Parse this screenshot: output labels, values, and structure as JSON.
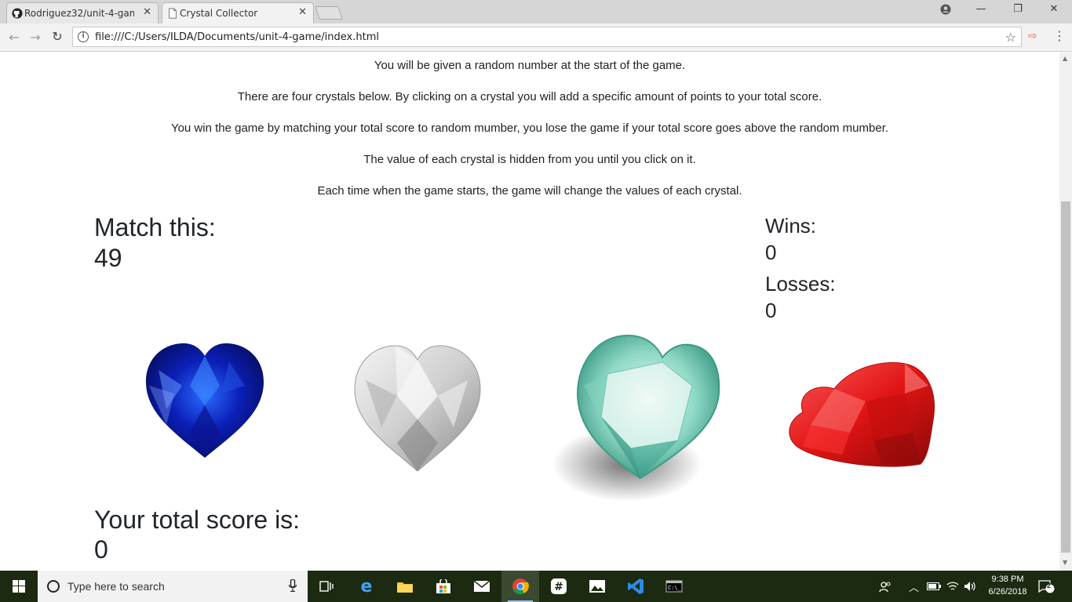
{
  "browser": {
    "tabs": [
      {
        "label": "Rodriguez32/unit-4-gam",
        "icon": "github-icon",
        "active": false
      },
      {
        "label": "Crystal Collector",
        "icon": "page-icon",
        "active": true
      }
    ],
    "url": "file:///C:/Users/ILDA/Documents/unit-4-game/index.html"
  },
  "page": {
    "instructions": [
      "You will be given a random number at the start of the game.",
      "There are four crystals below. By clicking on a crystal you will add a specific amount of points to your total score.",
      "You win the game by matching your total score to random mumber, you lose the game if your total score goes above the random mumber.",
      "The value of each crystal is hidden from you until you click on it.",
      "Each time when the game starts, the game will change the values of each crystal."
    ],
    "match_label": "Match this:",
    "match_value": "49",
    "wins_label": "Wins:",
    "wins_value": "0",
    "losses_label": "Losses:",
    "losses_value": "0",
    "total_label": "Your total score is:",
    "total_value": "0",
    "crystals": [
      {
        "name": "blue-heart-crystal",
        "color": "#0a1aa8"
      },
      {
        "name": "clear-heart-crystal",
        "color": "#d8d8d8"
      },
      {
        "name": "aqua-heart-crystal",
        "color": "#6fc9b4"
      },
      {
        "name": "red-heart-crystal",
        "color": "#d81818"
      }
    ]
  },
  "taskbar": {
    "search_placeholder": "Type here to search",
    "time": "9:38 PM",
    "date": "6/26/2018",
    "notifications": "2"
  }
}
